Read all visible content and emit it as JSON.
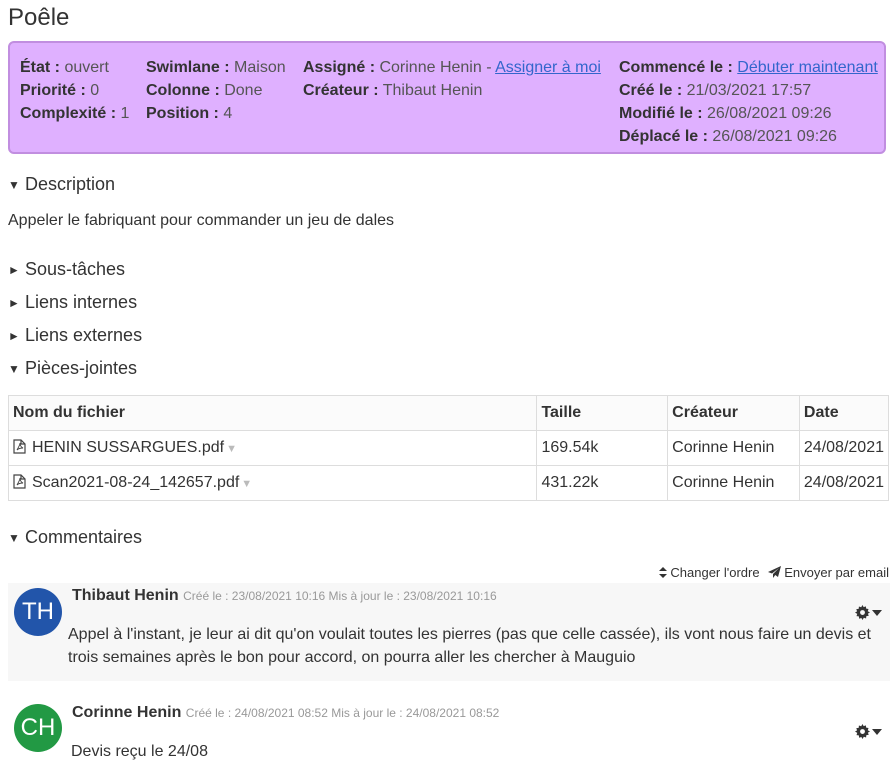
{
  "task": {
    "title": "Poêle"
  },
  "summary": {
    "col1": [
      {
        "label": "État :",
        "value": "ouvert"
      },
      {
        "label": "Priorité :",
        "value": "0"
      },
      {
        "label": "Complexité :",
        "value": "1"
      }
    ],
    "col2": [
      {
        "label": "Swimlane :",
        "value": "Maison"
      },
      {
        "label": "Colonne :",
        "value": "Done"
      },
      {
        "label": "Position :",
        "value": "4"
      }
    ],
    "assignee_label": "Assigné :",
    "assignee_value": "Corinne Henin -",
    "assign_me_link": "Assigner à moi",
    "creator_label": "Créateur :",
    "creator_value": "Thibaut Henin",
    "started_label": "Commencé le :",
    "start_now_link": "Débuter maintenant",
    "created_label": "Créé le :",
    "created_value": "21/03/2021 17:57",
    "modified_label": "Modifié le :",
    "modified_value": "26/08/2021 09:26",
    "moved_label": "Déplacé le :",
    "moved_value": "26/08/2021 09:26"
  },
  "sections": {
    "description": "Description",
    "description_text": "Appeler le fabriquant pour commander un jeu de dales",
    "subtasks": "Sous-tâches",
    "internal_links": "Liens internes",
    "external_links": "Liens externes",
    "attachments": "Pièces-jointes",
    "comments": "Commentaires"
  },
  "attachments": {
    "headers": [
      "Nom du fichier",
      "Taille",
      "Créateur",
      "Date"
    ],
    "rows": [
      {
        "name": "HENIN SUSSARGUES.pdf",
        "size": "169.54k",
        "creator": "Corinne Henin",
        "date": "24/08/2021"
      },
      {
        "name": "Scan2021-08-24_142657.pdf",
        "size": "431.22k",
        "creator": "Corinne Henin",
        "date": "24/08/2021"
      }
    ]
  },
  "comment_actions": {
    "change_order": "Changer l'ordre",
    "send_email": "Envoyer par email"
  },
  "comments": [
    {
      "initials": "TH",
      "author": "Thibaut Henin",
      "meta": "Créé le : 23/08/2021 10:16 Mis à jour le : 23/08/2021 10:16",
      "text": "Appel à l'instant, je leur ai dit qu'on voulait toutes les pierres (pas que celle cassée), ils vont nous faire un devis et trois semaines après le bon pour accord, on pourra aller les chercher à Mauguio",
      "avatar_color": "#2255aa"
    },
    {
      "initials": "CH",
      "author": "Corinne Henin",
      "meta": "Créé le : 24/08/2021 08:52 Mis à jour le : 24/08/2021 08:52",
      "text": "Devis reçu le 24/08",
      "avatar_color": "#229944"
    }
  ],
  "colors": {
    "summary_bg": "#dfb0ff",
    "summary_border": "#c18ee0",
    "link": "#3366cc"
  },
  "icons": {
    "section_open": "triangle-down-icon",
    "section_closed": "triangle-right-icon",
    "file": "pdf-file-icon",
    "settings": "gear-icon"
  }
}
